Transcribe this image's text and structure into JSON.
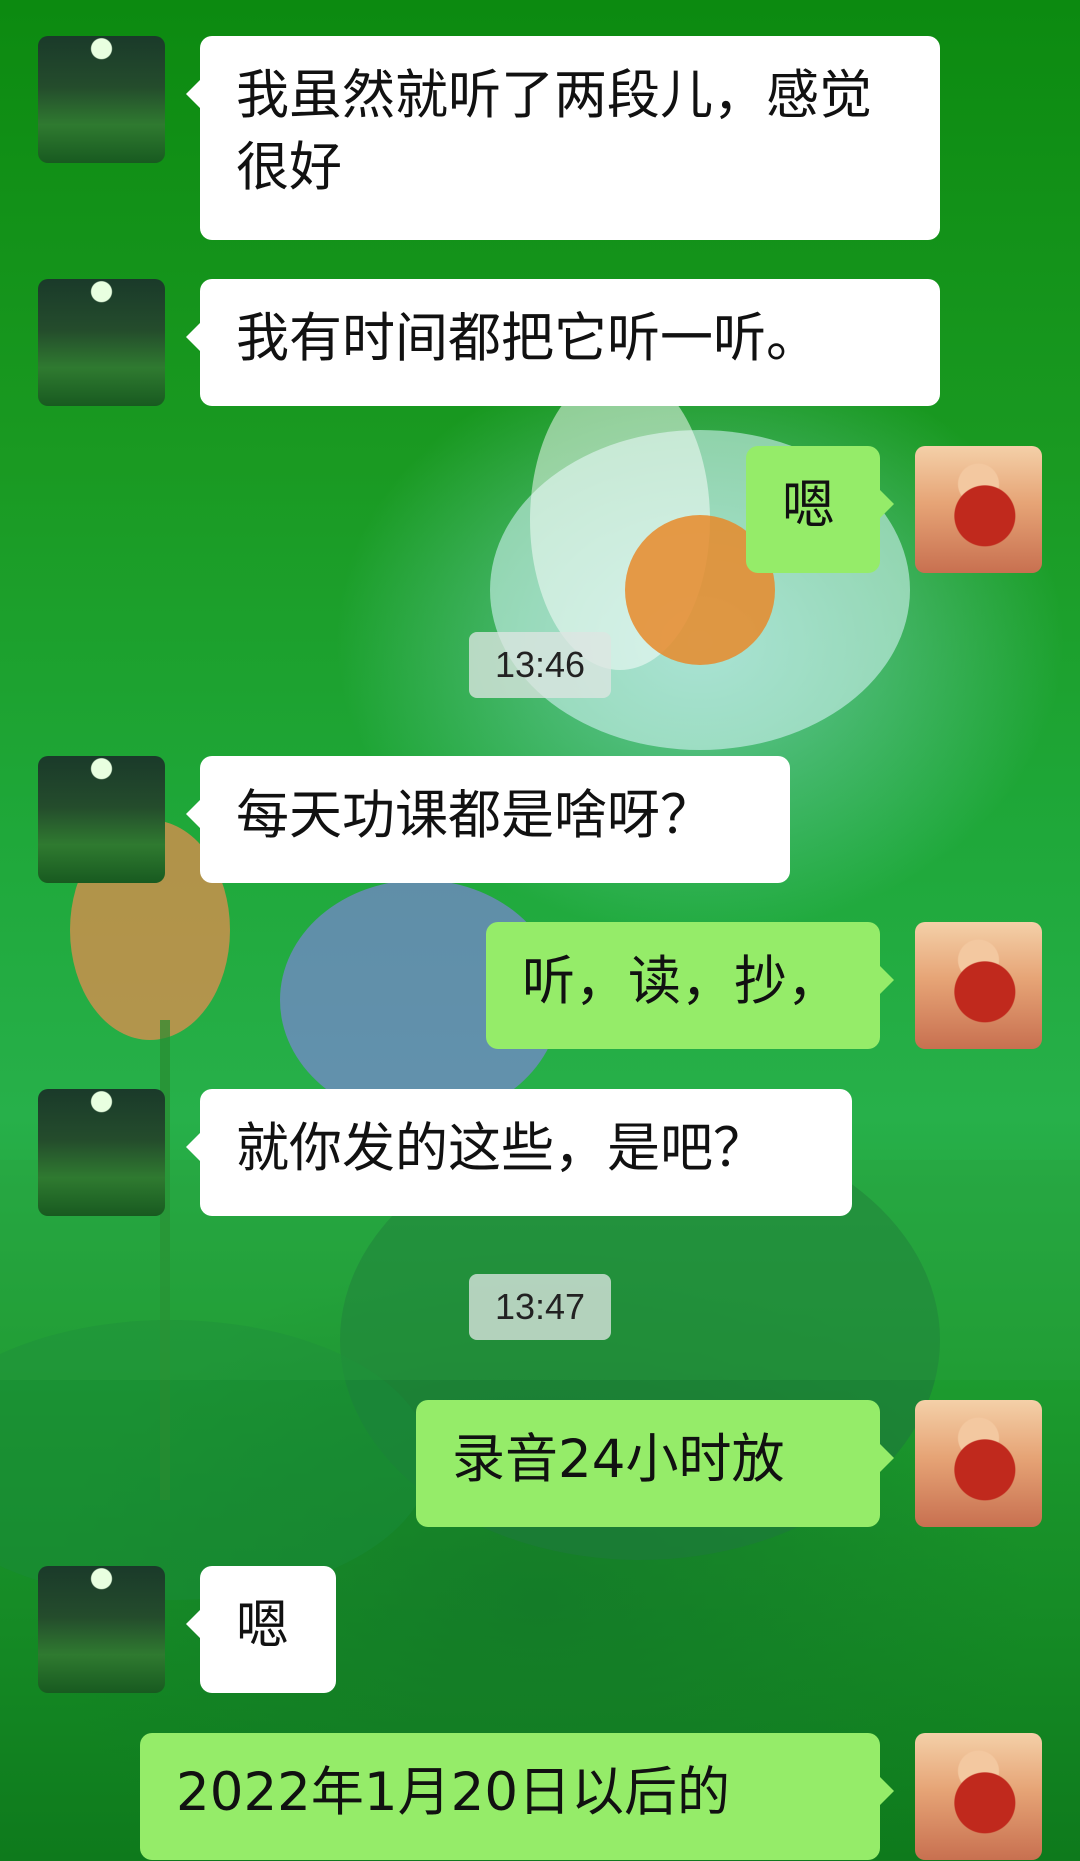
{
  "conversation": {
    "messages": [
      {
        "side": "left",
        "text": "我虽然就听了两段儿，感觉很好"
      },
      {
        "side": "left",
        "text": "我有时间都把它听一听。"
      },
      {
        "side": "right",
        "text": "嗯"
      },
      {
        "side": "time",
        "text": "13:46"
      },
      {
        "side": "left",
        "text": "每天功课都是啥呀？"
      },
      {
        "side": "right",
        "text": "听，读，抄，"
      },
      {
        "side": "left",
        "text": "就你发的这些，是吧？"
      },
      {
        "side": "time",
        "text": "13:47"
      },
      {
        "side": "right",
        "text": "录音24小时放"
      },
      {
        "side": "left",
        "text": "嗯"
      },
      {
        "side": "right",
        "text": "2022年1月20日以后的"
      }
    ]
  },
  "colors": {
    "incoming_bubble": "#ffffff",
    "outgoing_bubble": "#95ec69",
    "background": "#1fa83a"
  },
  "icons": {
    "left_avatar": "moonlit-garden-avatar",
    "right_avatar": "girl-with-star-avatar"
  }
}
